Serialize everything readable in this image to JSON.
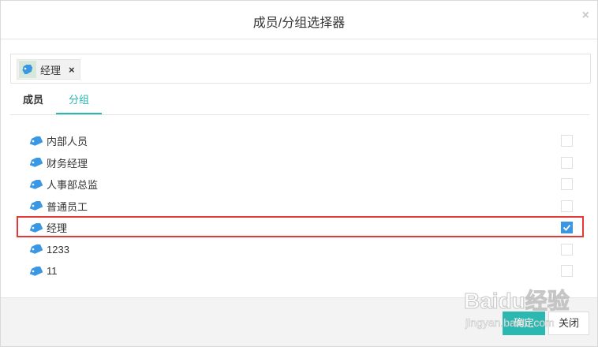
{
  "dialog": {
    "title": "成员/分组选择器",
    "close_symbol": "×"
  },
  "selected": {
    "chips": [
      {
        "label": "经理",
        "remove_symbol": "×"
      }
    ]
  },
  "tabs": [
    {
      "label": "成员",
      "active": false
    },
    {
      "label": "分组",
      "active": true
    }
  ],
  "groups": [
    {
      "label": "内部人员",
      "checked": false
    },
    {
      "label": "财务经理",
      "checked": false
    },
    {
      "label": "人事部总监",
      "checked": false
    },
    {
      "label": "普通员工",
      "checked": false
    },
    {
      "label": "经理",
      "checked": true
    },
    {
      "label": "1233",
      "checked": false
    },
    {
      "label": "11",
      "checked": false
    }
  ],
  "footer": {
    "ok_label": "确定",
    "close_label": "关闭"
  },
  "watermark": {
    "brand": "Baidu经验",
    "url": "jingyan.baidu.com"
  },
  "colors": {
    "accent": "#26b7b0",
    "checkbox_checked": "#3a97e3",
    "highlight": "#e53935",
    "tag_icon": "#3a97e3"
  },
  "icons": {
    "group": "tag-icon",
    "close": "close-icon",
    "check": "checkmark-icon"
  }
}
